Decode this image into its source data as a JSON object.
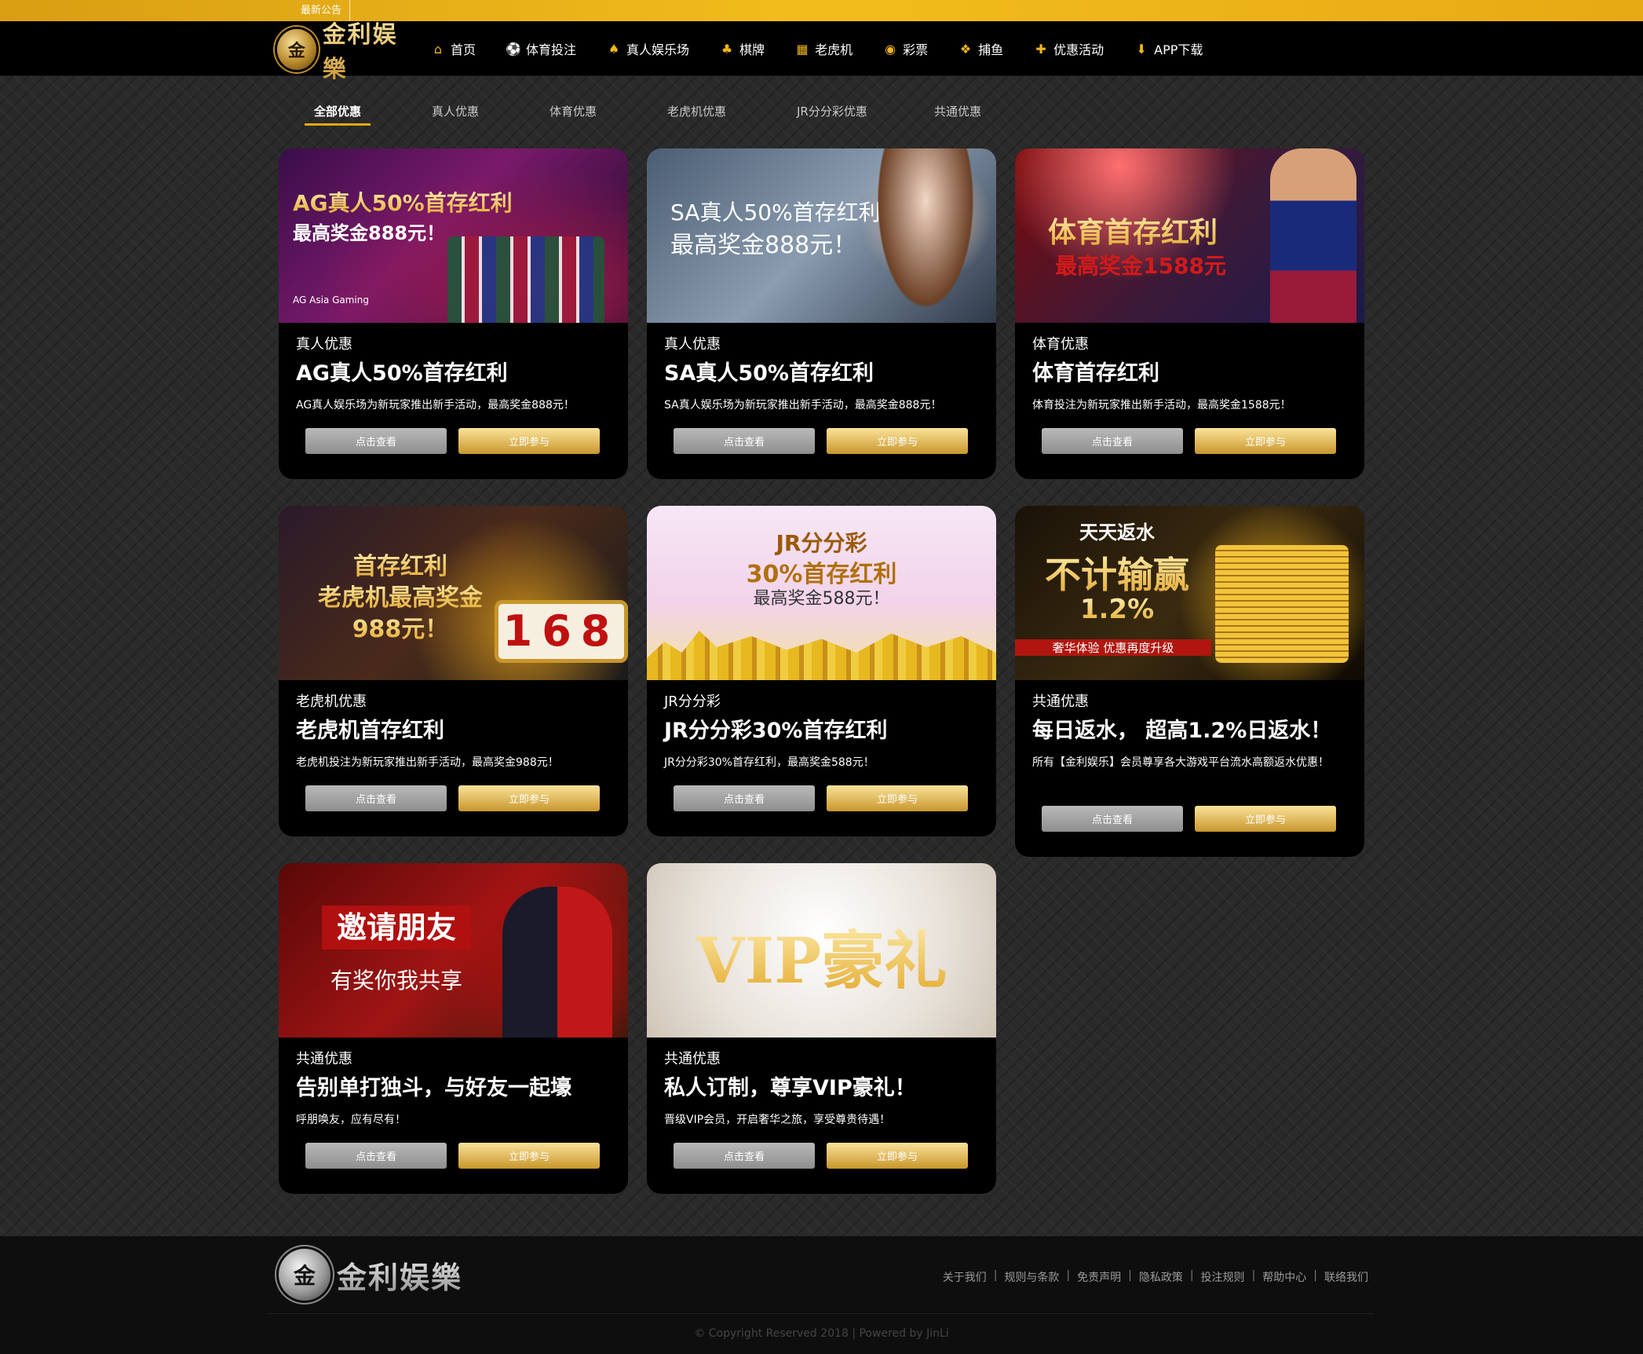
{
  "topbar": {
    "notice_label": "最新公告"
  },
  "brand": {
    "logo_char": "金",
    "logo_text": "金利娱樂"
  },
  "nav": [
    {
      "label": "首页",
      "icon": "home-icon",
      "glyph": "⌂"
    },
    {
      "label": "体育投注",
      "icon": "soccer-ball-icon",
      "glyph": "⚽"
    },
    {
      "label": "真人娱乐场",
      "icon": "dealer-card-icon",
      "glyph": "♠"
    },
    {
      "label": "棋牌",
      "icon": "playing-cards-icon",
      "glyph": "♣"
    },
    {
      "label": "老虎机",
      "icon": "slot-machine-icon",
      "glyph": "▦"
    },
    {
      "label": "彩票",
      "icon": "lottery-ball-icon",
      "glyph": "◉"
    },
    {
      "label": "捕鱼",
      "icon": "fish-icon",
      "glyph": "❖"
    },
    {
      "label": "优惠活动",
      "icon": "gift-icon",
      "glyph": "✚"
    },
    {
      "label": "APP下载",
      "icon": "download-icon",
      "glyph": "⬇"
    }
  ],
  "tabs": [
    "全部优惠",
    "真人优惠",
    "体育优惠",
    "老虎机优惠",
    "JR分分彩优惠",
    "共通优惠"
  ],
  "buttons": {
    "view": "点击查看",
    "join": "立即参与"
  },
  "cards": [
    {
      "category": "真人优惠",
      "title": "AG真人50%首存红利",
      "desc": "AG真人娱乐场为新玩家推出新手活动，最高奖金888元！",
      "banner_line1": "AG真人50%首存红利",
      "banner_line2": "最高奖金888元！",
      "banner_tag": "AG Asia Gaming"
    },
    {
      "category": "真人优惠",
      "title": "SA真人50%首存红利",
      "desc": "SA真人娱乐场为新玩家推出新手活动，最高奖金888元！",
      "banner_line1": "SA真人50%首存红利",
      "banner_line2": "最高奖金888元！"
    },
    {
      "category": "体育优惠",
      "title": "体育首存红利",
      "desc": "体育投注为新玩家推出新手活动，最高奖金1588元！",
      "banner_line1": "体育首存红利",
      "banner_line2": "最高奖金1588元"
    },
    {
      "category": "老虎机优惠",
      "title": "老虎机首存红利",
      "desc": "老虎机投注为新玩家推出新手活动，最高奖金988元！",
      "banner_line1": "首存红利",
      "banner_line2": "老虎机最高奖金",
      "banner_line3": "988元！",
      "banner_reels": "168"
    },
    {
      "category": "JR分分彩",
      "title": "JR分分彩30%首存红利",
      "desc": "JR分分彩30%首存红利，最高奖金588元！",
      "banner_line1": "JR分分彩",
      "banner_line2": "30%首存红利",
      "banner_line3": "最高奖金588元！"
    },
    {
      "category": "共通优惠",
      "title": "每日返水， 超高1.2%日返水！",
      "desc": "所有【金利娱乐】会员尊享各大游戏平台流水高额返水优惠！",
      "banner_line1": "天天返水",
      "banner_line2": "不计输赢",
      "banner_line3": "1.2%",
      "banner_tag": "奢华体验 优惠再度升级"
    },
    {
      "category": "共通优惠",
      "title": "告别单打独斗，与好友一起壕",
      "desc": "呼朋唤友，应有尽有！",
      "banner_line1": "邀请朋友",
      "banner_line2": "有奖你我共享"
    },
    {
      "category": "共通优惠",
      "title": "私人订制，尊享VIP豪礼！",
      "desc": "晋级VIP会员，开启奢华之旅，享受尊贵待遇！",
      "banner_line1": "VIP豪礼"
    }
  ],
  "footer": {
    "logo_char": "金",
    "logo_text": "金利娱樂",
    "links": [
      "关于我们",
      "规则与条款",
      "免责声明",
      "隐私政策",
      "投注规则",
      "帮助中心",
      "联络我们"
    ],
    "copyright": "© Copyright Reserved 2018 | Powered by JinLi"
  }
}
